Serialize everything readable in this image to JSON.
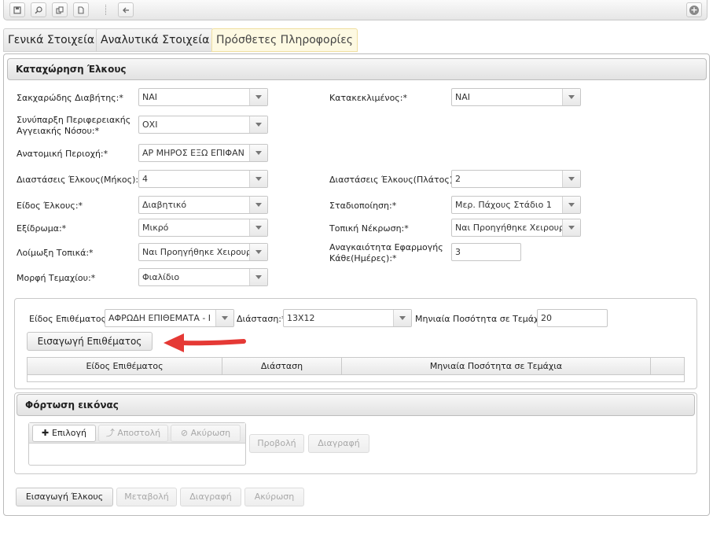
{
  "toolbar": {
    "icons": [
      "save-icon",
      "search-icon",
      "copy-icon",
      "new-document-icon",
      "back-arrow-icon",
      "add-icon"
    ]
  },
  "tabs": [
    {
      "label": "Γενικά Στοιχεία",
      "active": false
    },
    {
      "label": "Αναλυτικά Στοιχεία",
      "active": false
    },
    {
      "label": "Πρόσθετες Πληροφορίες",
      "active": true
    }
  ],
  "form": {
    "title": "Καταχώρηση Έλκους",
    "left": {
      "diabetic": {
        "label": "Σακχαρώδης Διαβήτης:*",
        "value": "ΝΑΙ"
      },
      "vascular": {
        "label": "Συνύπαρξη Περιφερειακής Αγγειακής Νόσου:*",
        "value": "ΟΧΙ"
      },
      "region": {
        "label": "Ανατομική Περιοχή:*",
        "value": "ΑΡ ΜΗΡΟΣ ΕΞΩ ΕΠΙΦΑΝ"
      },
      "length": {
        "label": "Διαστάσεις Έλκους(Μήκος):*",
        "value": "4"
      },
      "type": {
        "label": "Είδος Έλκους:*",
        "value": "Διαβητικό"
      },
      "exudate": {
        "label": "Εξίδρωμα:*",
        "value": "Μικρό"
      },
      "infection": {
        "label": "Λοίμωξη Τοπικά:*",
        "value": "Ναι Προηγήθηκε Χειρουρ"
      },
      "piece_form": {
        "label": "Μορφή Τεμαχίου:*",
        "value": "Φιαλίδιο"
      }
    },
    "right": {
      "bedridden": {
        "label": "Κατακεκλιμένος:*",
        "value": "ΝΑΙ"
      },
      "width": {
        "label": "Διαστάσεις Έλκους(Πλάτος):*",
        "value": "2"
      },
      "staging": {
        "label": "Σταδιοποίηση:*",
        "value": "Μερ. Πάχους Στάδιο 1"
      },
      "necrosis": {
        "label": "Τοπική Νέκρωση:*",
        "value": "Ναι Προηγήθηκε Χειρουρ"
      },
      "frequency": {
        "label": "Αναγκαιότητα Εφαρμογής Κάθε(Ημέρες):*",
        "value": "3"
      }
    }
  },
  "dressing": {
    "type_label": "Είδος Επιθέματος:*",
    "type_value": "ΑΦΡΩΔΗ ΕΠΙΘΕΜΑΤΑ - Ι",
    "size_label": "Διάσταση:*",
    "size_value": "13Χ12",
    "qty_label": "Μηνιαία Ποσότητα σε Τεμάχια:*",
    "qty_value": "20",
    "insert_button": "Εισαγωγή Επιθέματος",
    "grid_headers": [
      "Είδος Επιθέματος",
      "Διάσταση",
      "Μηνιαία Ποσότητα σε Τεμάχια"
    ]
  },
  "upload": {
    "title": "Φόρτωση εικόνας",
    "select": "Επιλογή",
    "send": "Αποστολή",
    "cancel": "Ακύρωση",
    "view": "Προβολή",
    "delete": "Διαγραφή"
  },
  "actions": {
    "insert": "Εισαγωγή Έλκους",
    "modify": "Μεταβολή",
    "delete": "Διαγραφή",
    "cancel": "Ακύρωση"
  },
  "colors": {
    "active_tab_bg": "#fdf9e2",
    "annotation_arrow": "#e53935"
  }
}
